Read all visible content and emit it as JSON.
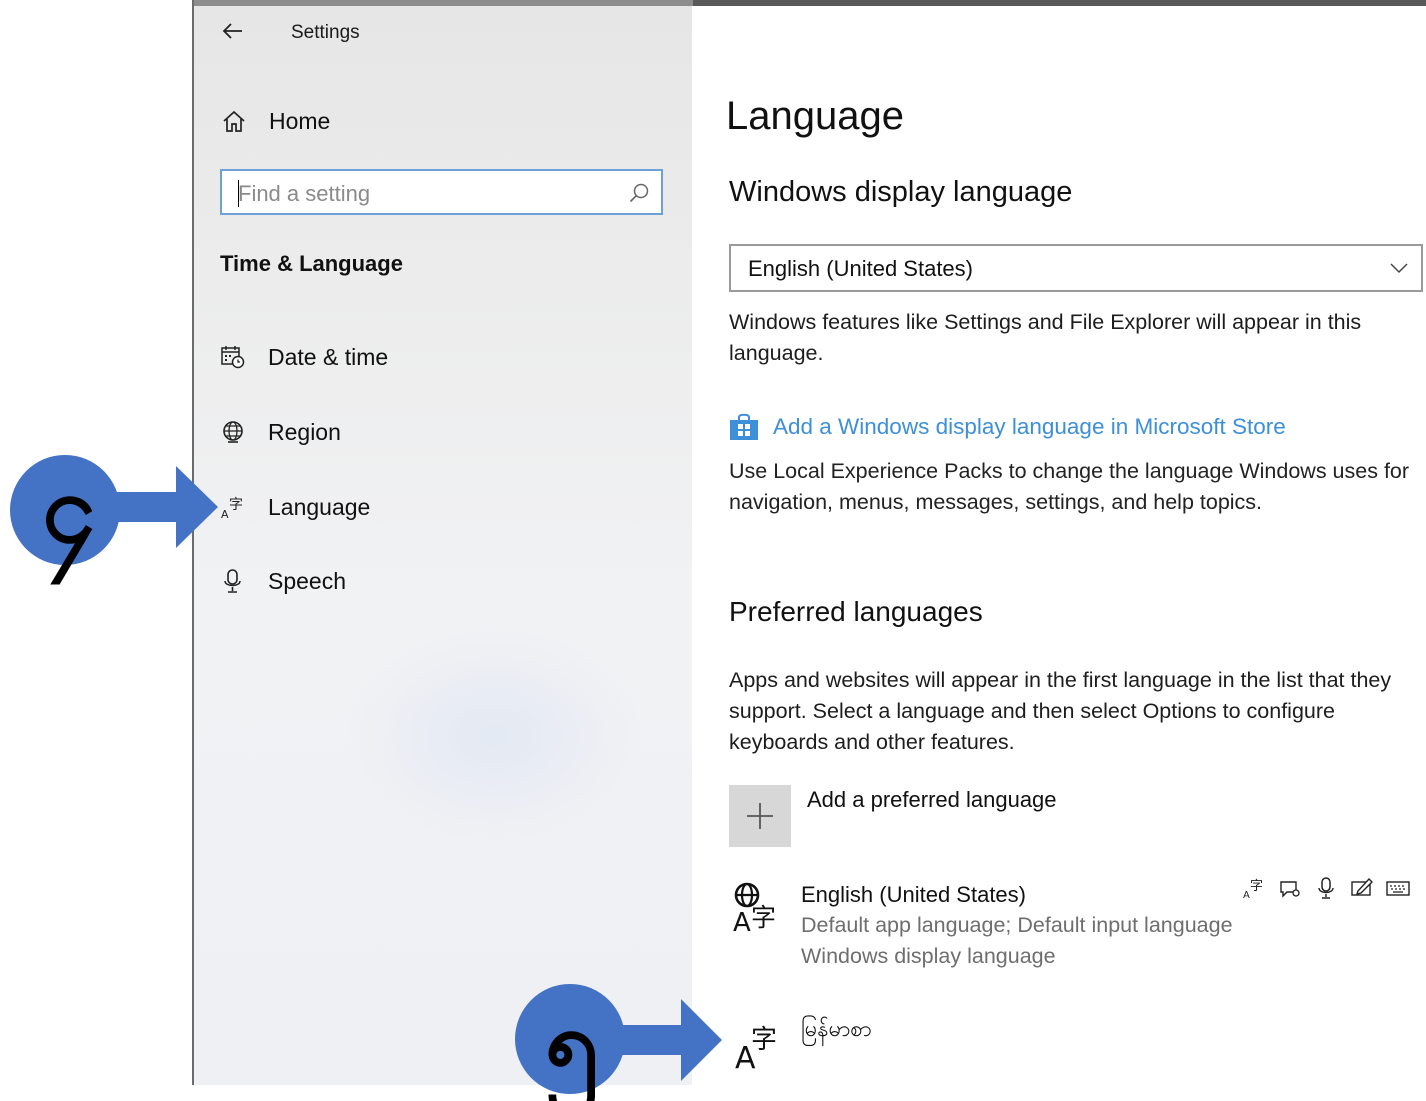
{
  "window": {
    "title": "Settings"
  },
  "sidebar": {
    "home_label": "Home",
    "search_placeholder": "Find a setting",
    "section_title": "Time & Language",
    "items": [
      {
        "label": "Date & time",
        "icon": "calendar-clock-icon"
      },
      {
        "label": "Region",
        "icon": "globe-icon"
      },
      {
        "label": "Language",
        "icon": "language-icon"
      },
      {
        "label": "Speech",
        "icon": "microphone-icon"
      }
    ]
  },
  "main": {
    "title": "Language",
    "display_language": {
      "heading": "Windows display language",
      "selected": "English (United States)",
      "description": "Windows features like Settings and File Explorer will appear in this language.",
      "store_link": "Add a Windows display language in Microsoft Store",
      "store_description": "Use Local Experience Packs to change the language Windows uses for navigation, menus, messages, settings, and help topics."
    },
    "preferred": {
      "heading": "Preferred languages",
      "description": "Apps and websites will appear in the first language in the list that they support. Select a language and then select Options to configure keyboards and other features.",
      "add_label": "Add a preferred language",
      "languages": [
        {
          "name": "English (United States)",
          "details_line1": "Default app language; Default input language",
          "details_line2": "Windows display language",
          "features": [
            "language-pack-icon",
            "speech-display-icon",
            "microphone-icon",
            "handwriting-icon",
            "keyboard-icon"
          ]
        },
        {
          "name": "မြန်မာစာ"
        }
      ]
    }
  },
  "annotations": [
    {
      "number": "၄",
      "color": "#4472c4"
    },
    {
      "number": "၅",
      "color": "#4472c4"
    }
  ]
}
